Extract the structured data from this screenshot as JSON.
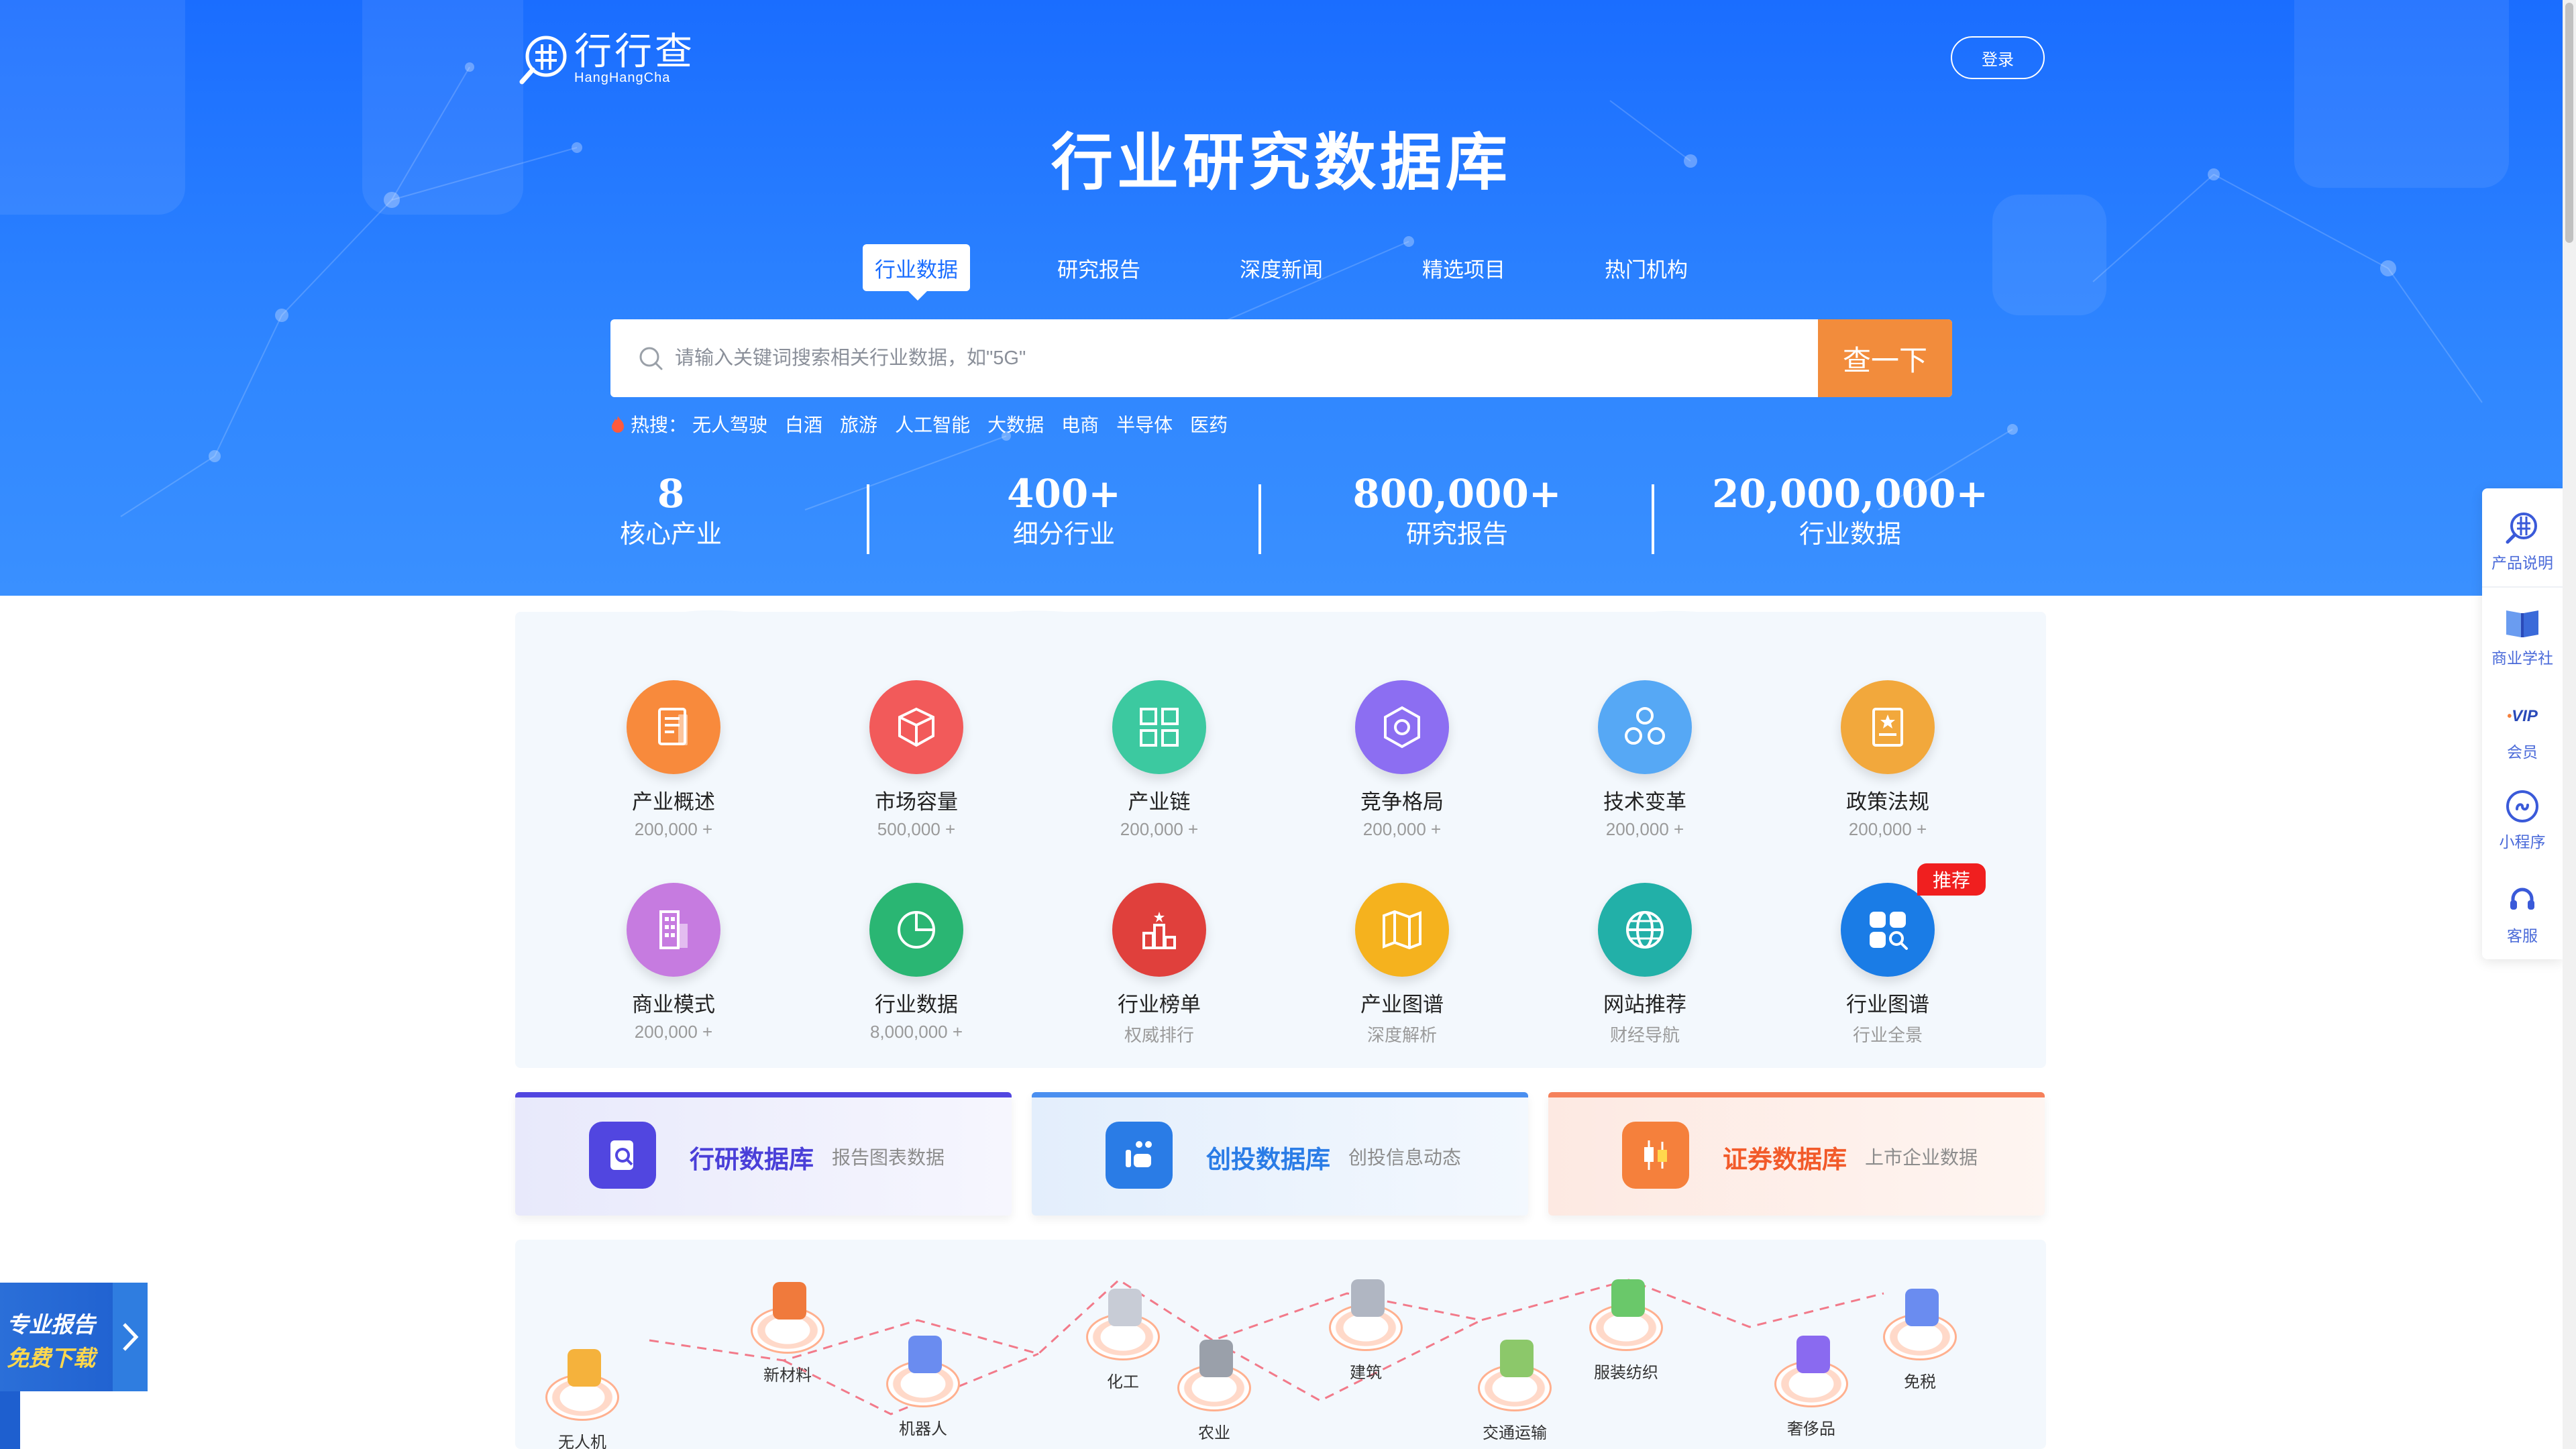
{
  "logo": {
    "cn": "行行查",
    "en": "HangHangCha"
  },
  "header": {
    "login_label": "登录"
  },
  "hero": {
    "title": "行业研究数据库"
  },
  "tabs": [
    {
      "label": "行业数据",
      "active": true
    },
    {
      "label": "研究报告"
    },
    {
      "label": "深度新闻"
    },
    {
      "label": "精选项目"
    },
    {
      "label": "热门机构"
    }
  ],
  "search": {
    "placeholder": "请输入关键词搜索相关行业数据，如\"5G\"",
    "button_label": "查一下"
  },
  "hot": {
    "label": "热搜：",
    "keywords": [
      "无人驾驶",
      "白酒",
      "旅游",
      "人工智能",
      "大数据",
      "电商",
      "半导体",
      "医药"
    ]
  },
  "stats": [
    {
      "number": "8",
      "label": "核心产业"
    },
    {
      "number": "400+",
      "label": "细分行业"
    },
    {
      "number": "800,000+",
      "label": "研究报告"
    },
    {
      "number": "20,000,000+",
      "label": "行业数据"
    }
  ],
  "categories": [
    {
      "name": "产业概述",
      "sub": "200,000 +",
      "color": "#f88a3c",
      "icon": "document-icon"
    },
    {
      "name": "市场容量",
      "sub": "500,000 +",
      "color": "#f25a5a",
      "icon": "cube-icon"
    },
    {
      "name": "产业链",
      "sub": "200,000 +",
      "color": "#3cc9a0",
      "icon": "chain-icon"
    },
    {
      "name": "竞争格局",
      "sub": "200,000 +",
      "color": "#8c6ef2",
      "icon": "hexagon-icon"
    },
    {
      "name": "技术变革",
      "sub": "200,000 +",
      "color": "#56a8f5",
      "icon": "molecule-icon"
    },
    {
      "name": "政策法规",
      "sub": "200,000 +",
      "color": "#f2a83c",
      "icon": "policy-icon"
    },
    {
      "name": "商业模式",
      "sub": "200,000 +",
      "color": "#c67be0",
      "icon": "building-icon"
    },
    {
      "name": "行业数据",
      "sub": "8,000,000 +",
      "color": "#2ab673",
      "icon": "pie-chart-icon"
    },
    {
      "name": "行业榜单",
      "sub": "权威排行",
      "color": "#e0403c",
      "icon": "ranking-icon"
    },
    {
      "name": "产业图谱",
      "sub": "深度解析",
      "color": "#f5b21e",
      "icon": "map-icon"
    },
    {
      "name": "网站推荐",
      "sub": "财经导航",
      "color": "#22b0a8",
      "icon": "globe-icon"
    },
    {
      "name": "行业图谱",
      "sub": "行业全景",
      "color": "#1a7ce6",
      "icon": "apps-search-icon"
    }
  ],
  "badge": {
    "label": "推荐"
  },
  "db_cards": [
    {
      "title": "行研数据库",
      "sub": "报告图表数据",
      "color": "#4a3fd8",
      "bar": "#5146e0"
    },
    {
      "title": "创投数据库",
      "sub": "创投信息动态",
      "color": "#2a7ce6",
      "bar": "#4a8ff0"
    },
    {
      "title": "证券数据库",
      "sub": "上市企业数据",
      "color": "#f25a2a",
      "bar": "#f5805a"
    }
  ],
  "map_nodes": [
    "新材料",
    "无人机",
    "机器人",
    "化工",
    "农业",
    "建筑",
    "交通运输",
    "服装纺织",
    "奢侈品",
    "免税"
  ],
  "sidebar": [
    {
      "label": "产品说明",
      "icon": "globe-search-icon"
    },
    {
      "label": "商业学社",
      "icon": "book-icon"
    },
    {
      "label": "会员",
      "icon": "vip-icon",
      "mark": "VIP"
    },
    {
      "label": "小程序",
      "icon": "mini-program-icon"
    },
    {
      "label": "客服",
      "icon": "headset-icon"
    }
  ],
  "promo": {
    "line1": "专业报告",
    "line2": "免费下载"
  }
}
